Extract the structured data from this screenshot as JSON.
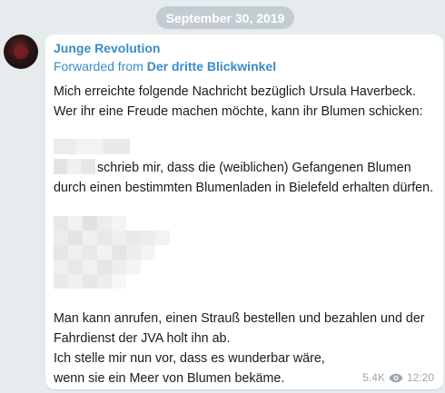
{
  "date_label": "September 30, 2019",
  "message": {
    "sender": "Junge Revolution",
    "forwarded_prefix": "Forwarded from",
    "forwarded_source": "Der dritte Blickwinkel",
    "paragraph_1": "Mich erreichte folgende Nachricht bezüglich Ursula Haverbeck. Wer ihr eine Freude machen möchte, kann ihr Blumen schicken:",
    "paragraph_2": "schrieb mir, dass die (weiblichen) Gefangenen Blumen durch einen bestimmten Blumenladen in Bielefeld erhalten dürfen.",
    "paragraph_3": "Man kann anrufen, einen Strauß bestellen und bezahlen und der Fahrdienst der JVA holt ihn ab.",
    "paragraph_4": "Ich stelle mir nun vor, dass es wunderbar wäre, wenn sie ein Meer von Blumen bekäme.",
    "views": "5.4K",
    "time": "12:20"
  },
  "icons": {
    "views": "eye-icon"
  },
  "colors": {
    "background": "#e6ebee",
    "link": "#3a8bc7",
    "date_pill": "#c3ccd3",
    "meta": "#9aa7b0"
  }
}
